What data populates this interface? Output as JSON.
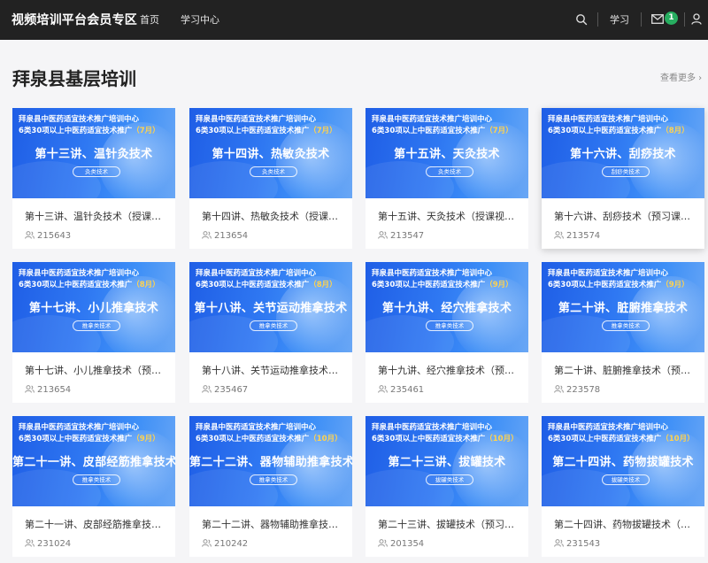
{
  "header": {
    "brand": "视频培训平台会员专区",
    "nav": [
      "首页",
      "学习中心"
    ],
    "study_link": "学习",
    "mail_count": "1",
    "icons": [
      "search-icon",
      "mail-icon",
      "user-icon"
    ]
  },
  "section": {
    "title": "拜泉县基层培训",
    "more": "查看更多 ›"
  },
  "thumb_common": {
    "org": "拜泉县中医药适宜技术推广培训中心",
    "sub_prefix": "6类30项以上中医药适宜技术推广"
  },
  "cards": [
    {
      "big": "第十三讲、温针灸技术",
      "month": "（7月）",
      "cat": "灸类技术",
      "title": "第十三讲、温针灸技术（授课视频）",
      "views": "215643"
    },
    {
      "big": "第十四讲、热敏灸技术",
      "month": "（7月）",
      "cat": "灸类技术",
      "title": "第十四讲、热敏灸技术（授课视频）",
      "views": "213654"
    },
    {
      "big": "第十五讲、天灸技术",
      "month": "（7月）",
      "cat": "灸类技术",
      "title": "第十五讲、天灸技术（授课视频）",
      "views": "213547"
    },
    {
      "big": "第十六讲、刮痧技术",
      "month": "（8月）",
      "cat": "刮痧类技术",
      "title": "第十六讲、刮痧技术（预习课件）",
      "views": "213574"
    },
    {
      "big": "第十七讲、小儿推拿技术",
      "month": "（8月）",
      "cat": "推拿类技术",
      "title": "第十七讲、小儿推拿技术（预习课件）",
      "views": "213654"
    },
    {
      "big": "第十八讲、关节运动推拿技术",
      "month": "（8月）",
      "cat": "推拿类技术",
      "title": "第十八讲、关节运动推拿技术（预习课件）",
      "views": "235467"
    },
    {
      "big": "第十九讲、经穴推拿技术",
      "month": "（9月）",
      "cat": "推拿类技术",
      "title": "第十九讲、经穴推拿技术（预习课件）",
      "views": "235461"
    },
    {
      "big": "第二十讲、脏腑推拿技术",
      "month": "（9月）",
      "cat": "推拿类技术",
      "title": "第二十讲、脏腑推拿技术（预习课件）",
      "views": "223578"
    },
    {
      "big": "第二十一讲、皮部经筋推拿技术",
      "month": "（9月）",
      "cat": "推拿类技术",
      "title": "第二十一讲、皮部经筋推拿技术（预习课件）",
      "views": "231024"
    },
    {
      "big": "第二十二讲、器物辅助推拿技术",
      "month": "（10月）",
      "cat": "推拿类技术",
      "title": "第二十二讲、器物辅助推拿技术（预习课件）",
      "views": "210242"
    },
    {
      "big": "第二十三讲、拔罐技术",
      "month": "（10月）",
      "cat": "拔罐类技术",
      "title": "第二十三讲、拔罐技术（预习课件）",
      "views": "201354"
    },
    {
      "big": "第二十四讲、药物拔罐技术",
      "month": "（10月）",
      "cat": "拔罐类技术",
      "title": "第二十四讲、药物拔罐技术（预习课件）",
      "views": "231543"
    }
  ]
}
